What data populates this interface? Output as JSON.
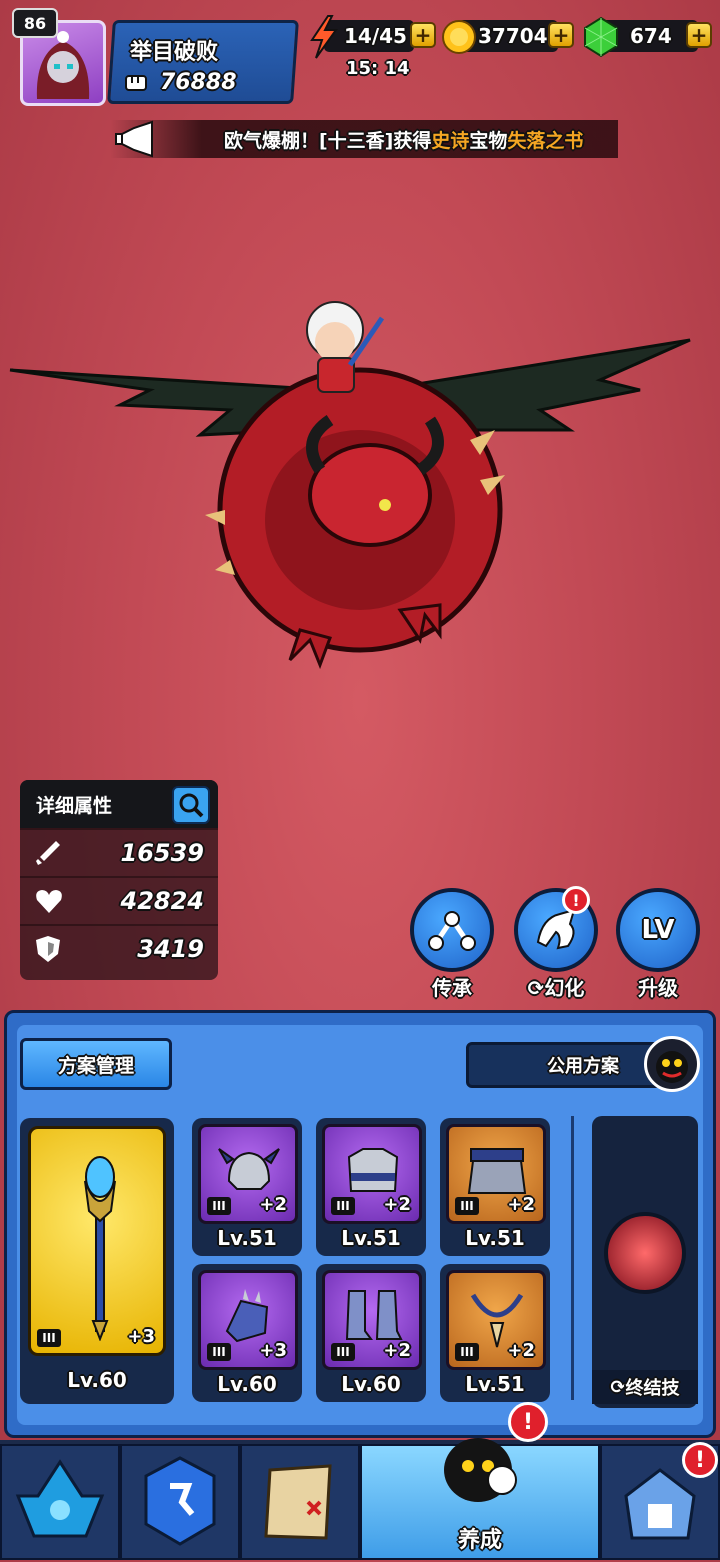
{
  "player": {
    "level": "86",
    "name": "举目破败",
    "power": "76888"
  },
  "resources": {
    "energy": "14/45",
    "energy_timer": "15: 14",
    "coins": "37704",
    "gems": "674"
  },
  "announcement": {
    "prefix": "欧气爆棚！[十三香]获得",
    "highlight1": "史诗",
    "mid": "宝物",
    "highlight2": "失落之书"
  },
  "stats": {
    "title": "详细属性",
    "attack": "16539",
    "hp": "42824",
    "defense": "3419"
  },
  "actions": {
    "inherit": "传承",
    "transform": "幻化",
    "upgrade": "升级",
    "upgrade_icon_text": "LV"
  },
  "equipment": {
    "manage_label": "方案管理",
    "shared_label": "公用方案",
    "weapon": {
      "level": "Lv.60",
      "plus": "+3",
      "tier": "III"
    },
    "slots": [
      {
        "level": "Lv.51",
        "plus": "+2",
        "tier": "III",
        "rarity": "purple",
        "icon": "helmet-icon"
      },
      {
        "level": "Lv.51",
        "plus": "+2",
        "tier": "III",
        "rarity": "purple",
        "icon": "armor-icon"
      },
      {
        "level": "Lv.51",
        "plus": "+2",
        "tier": "III",
        "rarity": "orange",
        "icon": "skirt-armor-icon"
      },
      {
        "level": "Lv.60",
        "plus": "+3",
        "tier": "III",
        "rarity": "purple",
        "icon": "gauntlet-icon"
      },
      {
        "level": "Lv.60",
        "plus": "+2",
        "tier": "III",
        "rarity": "purple",
        "icon": "boots-icon"
      },
      {
        "level": "Lv.51",
        "plus": "+2",
        "tier": "III",
        "rarity": "orange",
        "icon": "necklace-icon"
      }
    ],
    "ultimate_label": "终结技"
  },
  "nav": {
    "active_label": "养成",
    "badge": "!"
  },
  "colors": {
    "background": "#c24a55",
    "panel": "#2f6cc7",
    "gold": "#f5c400",
    "highlight_text": "#f5a623"
  }
}
